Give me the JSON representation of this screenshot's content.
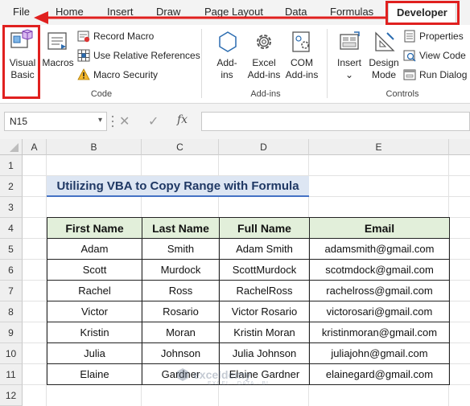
{
  "tabs": [
    "File",
    "Home",
    "Insert",
    "Draw",
    "Page Layout",
    "Data",
    "Formulas",
    "Developer"
  ],
  "active_tab": "Developer",
  "ribbon": {
    "code": {
      "label": "Code",
      "visual_basic": [
        "Visual",
        "Basic"
      ],
      "macros": "Macros",
      "record_macro": "Record Macro",
      "use_relative_references": "Use Relative References",
      "macro_security": "Macro Security"
    },
    "addins": {
      "label": "Add-ins",
      "addins_btn": [
        "Add-",
        "ins"
      ],
      "excel_addins": [
        "Excel",
        "Add-ins"
      ],
      "com_addins": [
        "COM",
        "Add-ins"
      ]
    },
    "controls": {
      "label": "Controls",
      "insert": "Insert",
      "insert_dd": "⌄",
      "design_mode": [
        "Design",
        "Mode"
      ],
      "properties": "Properties",
      "view_code": "View Code",
      "run_dialog": "Run Dialog"
    }
  },
  "formula_bar": {
    "name_box": "N15",
    "name_box_dd": "▾",
    "cancel": "✕",
    "enter": "✓",
    "fx": "fx",
    "formula": ""
  },
  "columns": [
    "A",
    "B",
    "C",
    "D",
    "E"
  ],
  "rows": [
    "1",
    "2",
    "3",
    "4",
    "5",
    "6",
    "7",
    "8",
    "9",
    "10",
    "11",
    "12"
  ],
  "sheet": {
    "title": "Utilizing VBA to Copy Range with Formula",
    "headers": [
      "First Name",
      "Last Name",
      "Full Name",
      "Email"
    ],
    "rows": [
      [
        "Adam",
        "Smith",
        "Adam Smith",
        "adamsmith@gmail.com"
      ],
      [
        "Scott",
        "Murdock",
        "ScottMurdock",
        "scotmdock@gmail.com"
      ],
      [
        "Rachel",
        "Ross",
        "RachelRoss",
        "rachelross@gmail.com"
      ],
      [
        "Victor",
        "Rosario",
        "Victor Rosario",
        "victorosari@gmail.com"
      ],
      [
        "Kristin",
        "Moran",
        "Kristin Moran",
        "kristinmoran@gmail.com"
      ],
      [
        "Julia",
        "Johnson",
        "Julia Johnson",
        "juliajohn@gmail.com"
      ],
      [
        "Elaine",
        "Gardner",
        "Elaine Gardner",
        "elainegard@gmail.com"
      ]
    ]
  },
  "watermark": {
    "name": "exceldemy",
    "sub": "EXCEL · DATA · BI"
  },
  "colors": {
    "accent_red": "#e0201f",
    "header_green": "#e2efda",
    "title_blue": "#dde6f3",
    "title_line": "#4472c4"
  }
}
